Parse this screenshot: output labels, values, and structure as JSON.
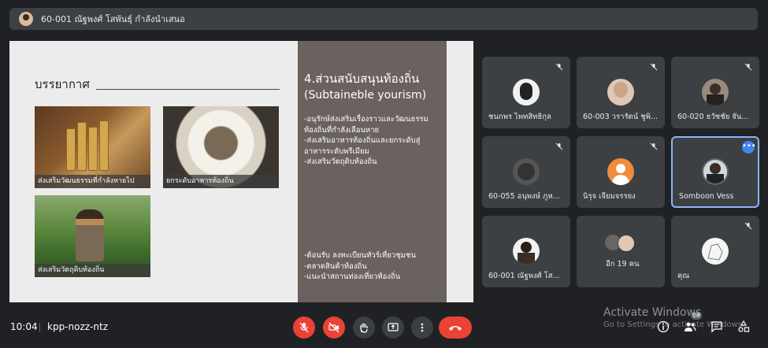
{
  "topbar": {
    "presenter_label": "60-001 ณัฐพงศ์ โสพันธุ์ กำลังนำเสนอ"
  },
  "slide": {
    "heading": "บรรยากาศ",
    "photos": [
      {
        "caption": "ส่งเสริมวัฒนธรรมที่กำลังหายไป"
      },
      {
        "caption": "ยกระดับอาหารท้องถิ่น"
      },
      {
        "caption": "ส่งเสริมวัตถุดิบท้องถิ่น"
      }
    ],
    "panel": {
      "title": "4.ส่วนสนับสนุนท้องถิ่น",
      "subtitle": "(Subtaineble yourism)",
      "list1": [
        "-อนุรักษ์ส่งเสริมเรื่องราวและวัฒนธรรม",
        "ท้องถิ่นที่กำลังเลือนหาย",
        "-ส่งเสริมอาหารท้องถิ่นและยกระดับสู่",
        "อาหารระดับพรีเมียม",
        "-ส่งเสริมวัตถุดิบท้องถิ่น"
      ],
      "list2": [
        "-ต้อนรับ ลงทะเบียนทัวร์เที่ยวชุมชน",
        "-ตลาดสินค้าท้องถิ่น",
        "-แนะนำสถานท่องเที่ยวท้องถิ่น"
      ]
    }
  },
  "participants": [
    {
      "name": "ชนกพร ไพทสิทธิกุล",
      "muted": true
    },
    {
      "name": "60-003 วรารัตน์ ชูพิ...",
      "muted": true
    },
    {
      "name": "60-020 ธวัชชัย จัน...",
      "muted": true
    },
    {
      "name": "60-055 อนุพงษ์ ภูห...",
      "muted": true
    },
    {
      "name": "นิรุจ เจียมจรรยง",
      "muted": true
    },
    {
      "name": "Somboon Vess",
      "muted": false
    },
    {
      "name": "60-001 ณัฐพงศ์ โส...",
      "muted": false
    },
    {
      "name": "อีก 19 คน",
      "muted": false
    },
    {
      "name": "คุณ",
      "muted": true
    }
  ],
  "bottombar": {
    "time": "10:04",
    "meeting_code": "kpp-nozz-ntz",
    "participant_count": "28"
  },
  "watermark": {
    "line1": "Activate Windows",
    "line2": "Go to Settings to activate Windows."
  },
  "colors": {
    "hangup": "#ea4335",
    "accent": "#8ab4f8",
    "background": "#202124"
  }
}
